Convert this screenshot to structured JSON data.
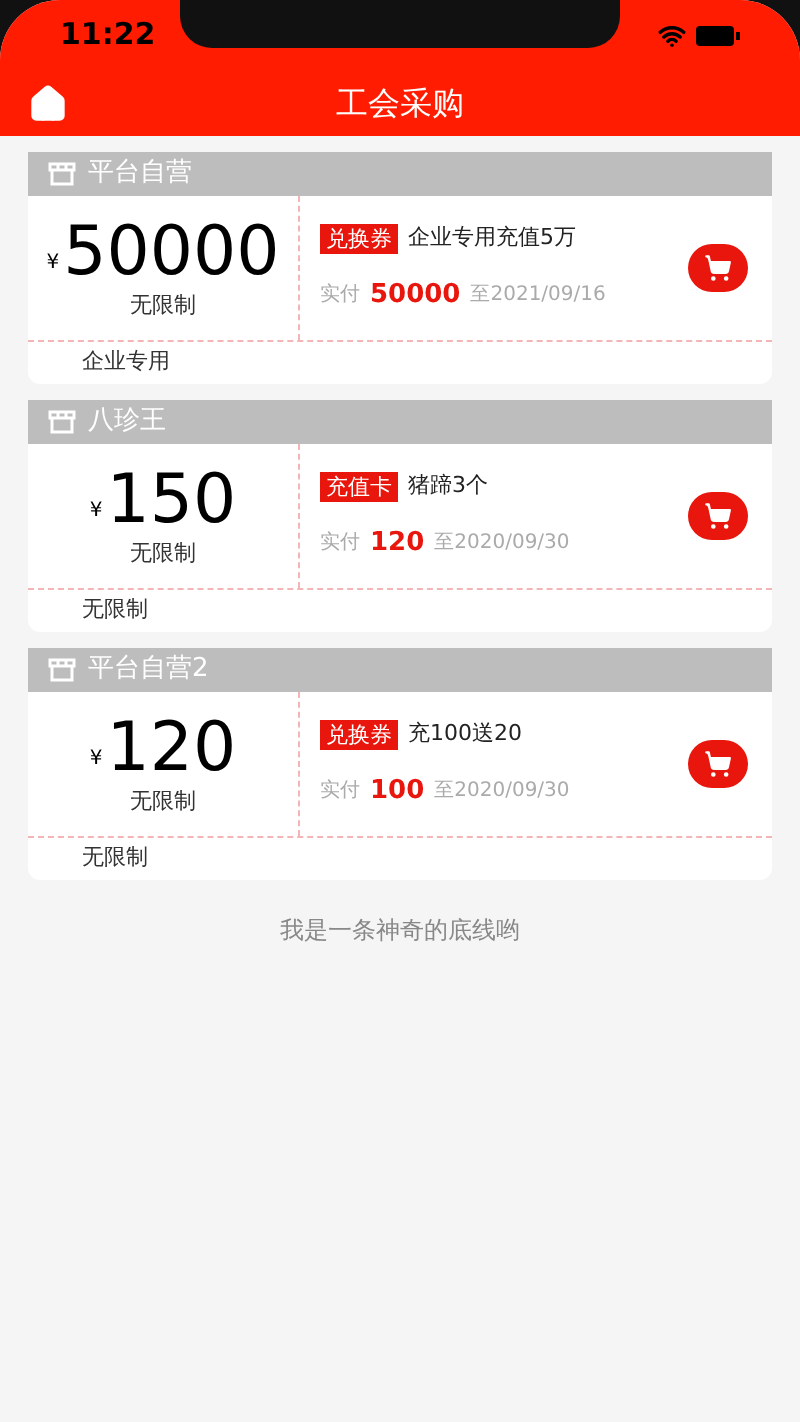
{
  "status_bar": {
    "time": "11:22"
  },
  "nav": {
    "title": "工会采购"
  },
  "cards": [
    {
      "shop": "平台自营",
      "currency": "¥",
      "amount": "50000",
      "limit": "无限制",
      "tag": "兑换券",
      "name": "企业专用充值5万",
      "paid_label": "实付",
      "paid": "50000",
      "expiry": "至2021/09/16",
      "note": "企业专用"
    },
    {
      "shop": "八珍王",
      "currency": "¥",
      "amount": "150",
      "limit": "无限制",
      "tag": "充值卡",
      "name": "猪蹄3个",
      "paid_label": "实付",
      "paid": "120",
      "expiry": "至2020/09/30",
      "note": "无限制"
    },
    {
      "shop": "平台自营2",
      "currency": "¥",
      "amount": "120",
      "limit": "无限制",
      "tag": "兑换券",
      "name": "充100送20",
      "paid_label": "实付",
      "paid": "100",
      "expiry": "至2020/09/30",
      "note": "无限制"
    }
  ],
  "footer": "我是一条神奇的底线哟"
}
